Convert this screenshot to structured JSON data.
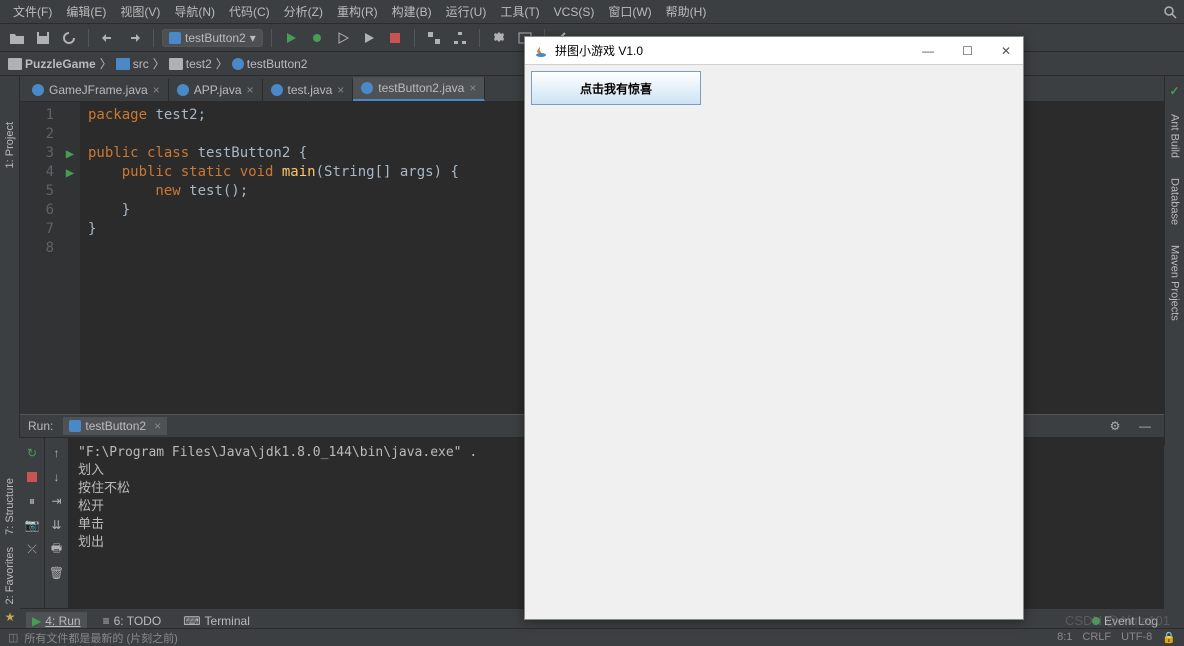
{
  "menu": {
    "file": "文件(F)",
    "edit": "编辑(E)",
    "view": "视图(V)",
    "nav": "导航(N)",
    "code": "代码(C)",
    "analyze": "分析(Z)",
    "refactor": "重构(R)",
    "build": "构建(B)",
    "run": "运行(U)",
    "tools": "工具(T)",
    "vcs": "VCS(S)",
    "window": "窗口(W)",
    "help": "帮助(H)"
  },
  "run_config": {
    "name": "testButton2"
  },
  "breadcrumb": {
    "project": "PuzzleGame",
    "src": "src",
    "pkg": "test2",
    "file": "testButton2"
  },
  "tabs": [
    {
      "label": "GameJFrame.java"
    },
    {
      "label": "APP.java"
    },
    {
      "label": "test.java"
    },
    {
      "label": "testButton2.java"
    }
  ],
  "code": {
    "l1": {
      "kw": "package",
      "rest": " test2;"
    },
    "l3": {
      "kw1": "public class ",
      "cls": "testButton2",
      "rest": " {"
    },
    "l4": {
      "kw1": "    public static void ",
      "fn": "main",
      "rest": "(String[] args) {"
    },
    "l5": {
      "kw1": "        new ",
      "call": "test();"
    },
    "l6": "    }",
    "l7": "}"
  },
  "left_tabs": {
    "project": "1: Project",
    "structure": "7: Structure",
    "favorites": "2: Favorites"
  },
  "right_tabs": {
    "ant": "Ant Build",
    "db": "Database",
    "maven": "Maven Projects"
  },
  "run_panel": {
    "title": "Run:",
    "tab": "testButton2",
    "lines": [
      "\"F:\\Program Files\\Java\\jdk1.8.0_144\\bin\\java.exe\" .",
      "划入",
      "按住不松",
      "松开",
      "单击",
      "划出"
    ]
  },
  "bottom": {
    "run": "4: Run",
    "todo": "6: TODO",
    "terminal": "Terminal",
    "eventlog": "Event Log"
  },
  "status": {
    "msg": "所有文件都是最新的 (片刻之前)",
    "pos": "8:1",
    "crlf": "CRLF",
    "enc": "UTF-8"
  },
  "jwindow": {
    "title": "拼图小游戏 V1.0",
    "button": "点击我有惊喜"
  },
  "watermark": "CSDN @Aluta101"
}
